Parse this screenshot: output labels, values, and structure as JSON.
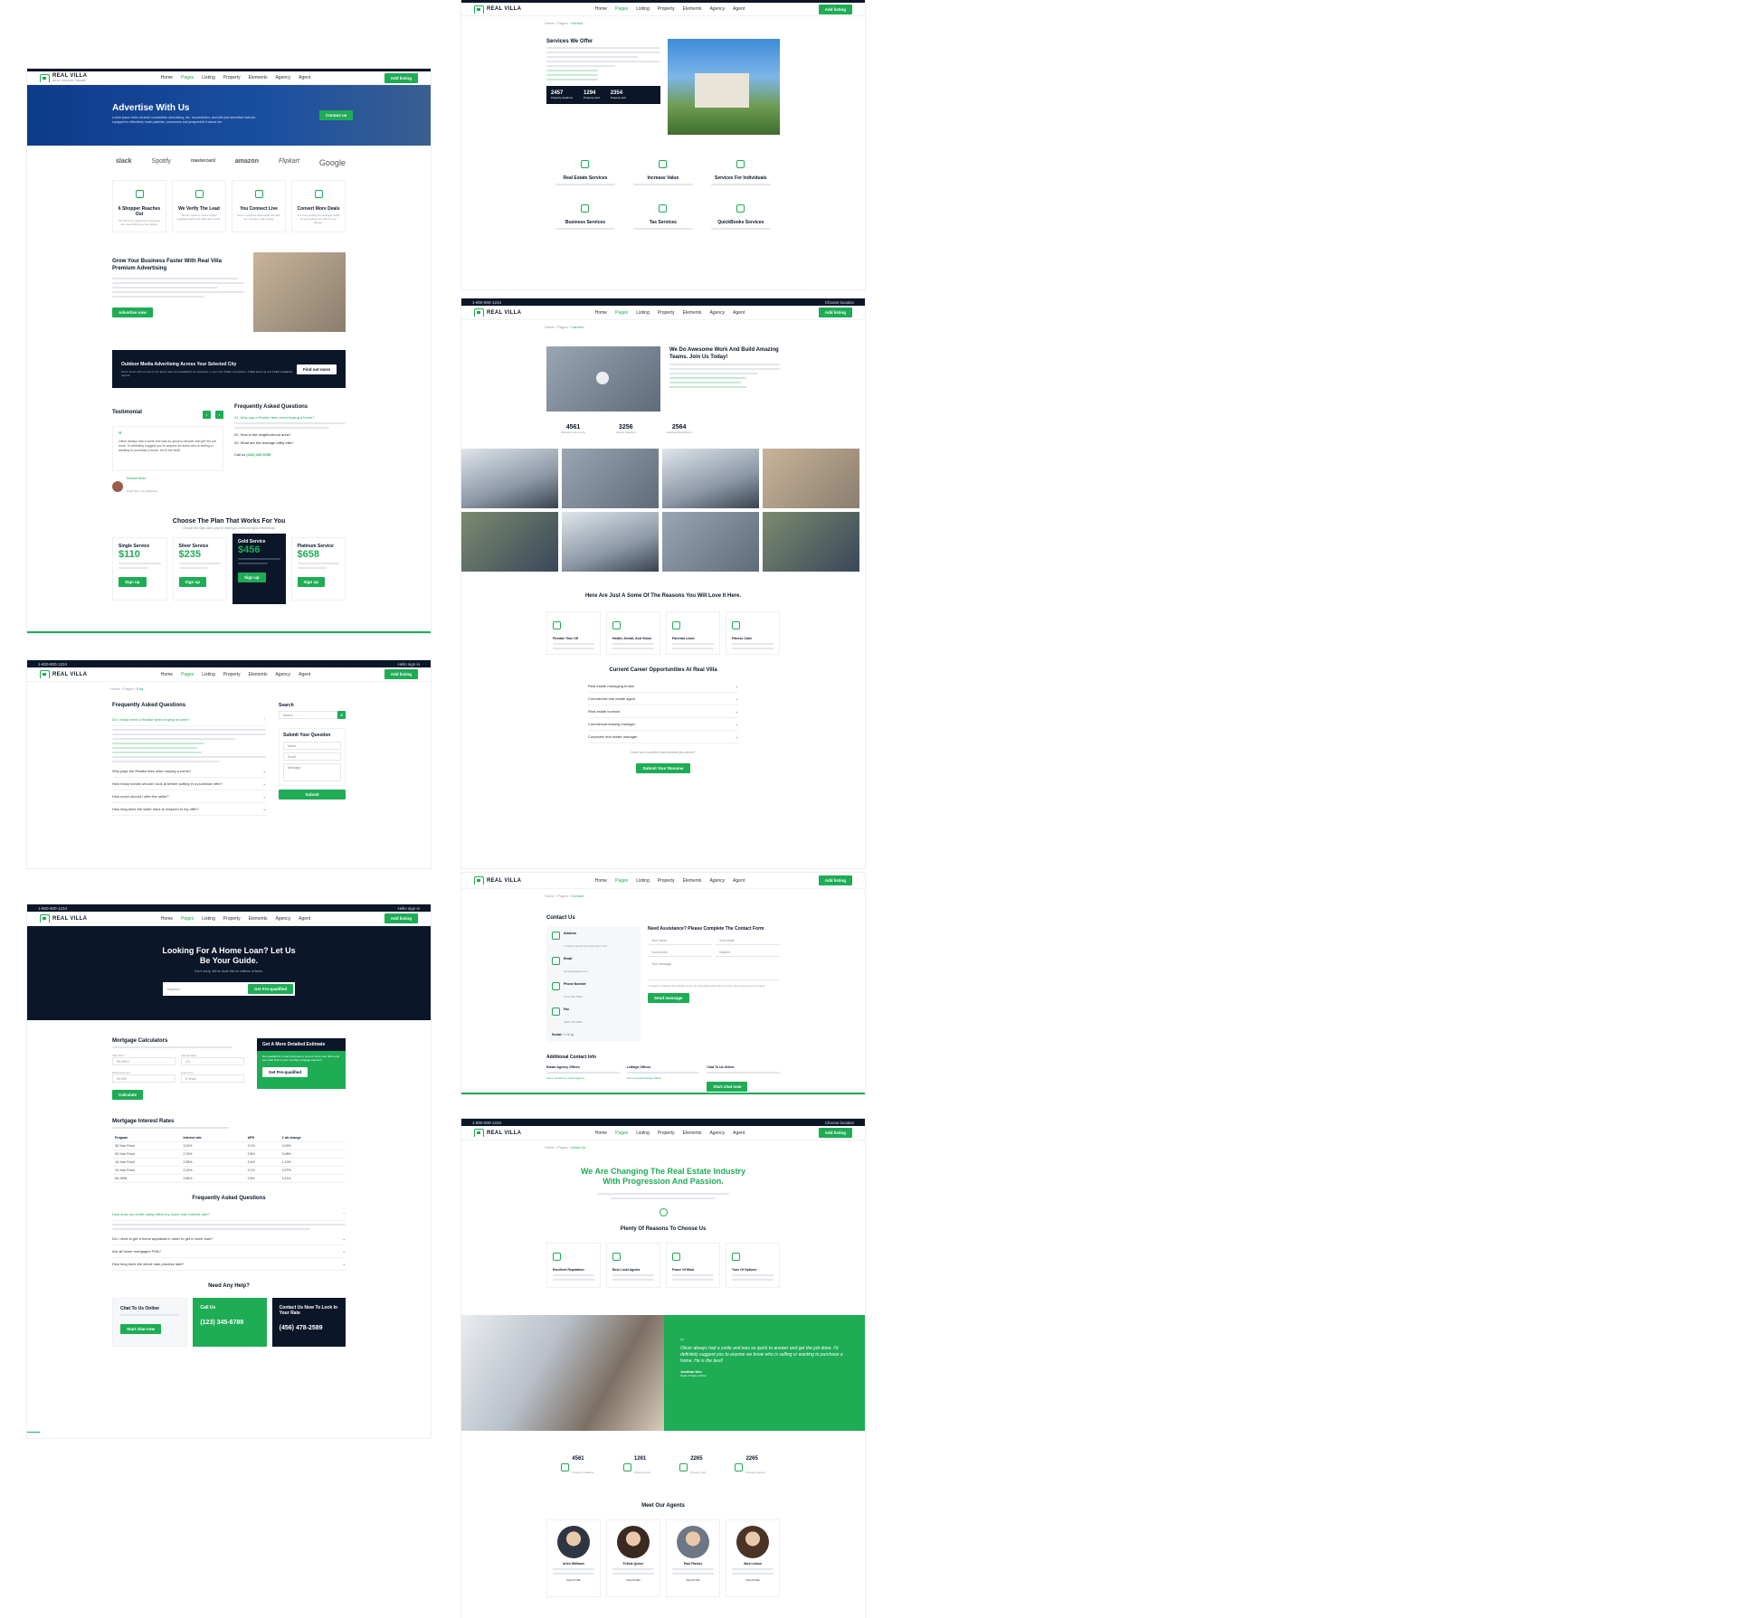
{
  "common": {
    "logo": {
      "name": "REAL VILLA",
      "tagline": "REAL ESTATE THEME"
    },
    "menu": [
      "Home",
      "Pages",
      "Listing",
      "Property",
      "Elements",
      "Agency",
      "Agent"
    ],
    "add_listing": "Add listing",
    "topbar_phone": "1-800-900-1234",
    "topbar_lang": "Get App",
    "topbar_location": "Choose location",
    "topbar_login": "Hello sign in",
    "crumb_home": "Home",
    "crumb_pages": "Pages"
  },
  "advertise": {
    "hero_title": "Advertise With Us",
    "hero_desc": "Lorem ipsum dolor sit amet consectetur advertising, etc. reconnection, and with just advertiser that are equipped to effectively reach patients, consumers and prospective it about are.",
    "hero_btn": "Contact us",
    "brands": [
      "slack",
      "Spotify",
      "mastercard",
      "amazon",
      "Flipkart",
      "Google"
    ],
    "features": [
      {
        "title": "6 Shopper Reaches Out",
        "desc": "The first is to reach key consumers who need what you are selling."
      },
      {
        "title": "We Verify The Lead",
        "desc": "We are quick to review highly engaged leads and pass fast results."
      },
      {
        "title": "You Connect Live",
        "desc": "See in real-time what leads are with our company and pricing."
      },
      {
        "title": "Convert More Deals",
        "desc": "It is true growing the average leads by generating any offers to go deeper."
      }
    ],
    "grow_title": "Grow Your Business Faster With Real Villa Premium Advertising",
    "grow_btn": "Advertise now",
    "outdoor_title": "Outdoor Media Advertising Across Your Selected City",
    "outdoor_desc": "Get in touch with us now for the latest rates and availability for anywhere in your City. FREE consultation, FREE planning and FREE availability reports.",
    "outdoor_btn": "Find out more",
    "testimonial_title": "Testimonial",
    "testimonial_quote": "Oliver always had a smile and was so quick to answer and get the job done. I'd definitely suggest you to anyone we know who is selling or wanting to purchase a home. He is the best!",
    "testimonial_name": "Michael Bean",
    "testimonial_role": "Head Mod, City Marketing",
    "faq_title": "Frequently Asked Questions",
    "faq": [
      "01. Why pay a Realtor fees when buying a home?",
      "02. How is the neighborhood area?",
      "03. What are the average utility bills?"
    ],
    "call_label": "Call us",
    "call_number": "(123) 345 6789",
    "plans_title": "Choose The Plan That Works For You",
    "plans_sub": "Choose the right plan, pay for what you need and grow effortlessly.",
    "plans": [
      {
        "name": "Single Service",
        "price": "$110",
        "btn": "Sign up"
      },
      {
        "name": "Silver Service",
        "price": "$235",
        "btn": "Sign up"
      },
      {
        "name": "Gold Service",
        "price": "$456",
        "btn": "Sign up"
      },
      {
        "name": "Platinum Service",
        "price": "$658",
        "btn": "Sign up"
      }
    ]
  },
  "faq_page": {
    "crumb": "Faq",
    "title": "Frequently Asked Questions",
    "open_q": "Do I really need a Realtor when buying a home?",
    "questions": [
      "Why pays the Realtor fees when buying a home?",
      "How many homes should I look at before putting in a purchase offer?",
      "How much should I offer the seller?",
      "How long does the seller have to respond to my offer?"
    ],
    "search_label": "Search",
    "search_placeholder": "Search ...",
    "submit_title": "Submit Your Question",
    "field_name": "Name",
    "field_email": "Email",
    "field_message": "Message",
    "submit_btn": "Submit"
  },
  "mortgage": {
    "hero_title": "Looking For A Home Loan? Let Us Be Your Guide.",
    "hero_sub": "Don't worry, We've done this for millions of times.",
    "hero_placeholder": "Keyword",
    "hero_btn": "Get Pre-qualified",
    "calc_title": "Mortgage Calculators",
    "calc_fields": [
      {
        "label": "Sale Price",
        "value": "60,000.0"
      },
      {
        "label": "Interest Rate",
        "value": "4.0"
      },
      {
        "label": "Down payment",
        "value": "20,000"
      },
      {
        "label": "Loan term",
        "value": "5 Years"
      }
    ],
    "calc_btn": "Calculate",
    "estimate_title": "Get A More Detailed Estimate",
    "estimate_desc": "Get qualified for a fast fixed-rate of current home loan offers and see what kind of your monthly mortgage payment.",
    "estimate_btn": "Get Pre-qualified",
    "rates_title": "Mortgage Interest Rates",
    "rates_head": [
      "Program",
      "Interest rate",
      "APR",
      "1 wk change"
    ],
    "rates": [
      [
        "30-Year Fixed",
        "3.20%",
        "3.1%",
        "0.02%"
      ],
      [
        "20-Year Fixed",
        "2.76%",
        "2.8%",
        "0.08%"
      ],
      [
        "15-Year Fixed",
        "2.38%",
        "2.4%",
        "1.10%"
      ],
      [
        "10-Year Fixed",
        "2.10%",
        "2.1%",
        "0.27%"
      ],
      [
        "5/1 ARM",
        "2.66%",
        "2.6%",
        "0.11%"
      ]
    ],
    "faq_title": "Frequently Asked Questions",
    "faq_open": "How does my credit rating affect my home loan interest rate?",
    "faq": [
      "Do I need to get a home appraisal in order to get a home loan?",
      "Are all home mortgages FHA?",
      "How long does the whole loan process take?"
    ],
    "help_title": "Need Any Help?",
    "help_cards": [
      {
        "title": "Chat To Us Online",
        "btn": "Start chat now"
      },
      {
        "title": "Call Us",
        "number": "(123) 345-6789"
      },
      {
        "title": "Contact Us Now To Lock In Your Rate",
        "number": "(456) 478-2589"
      }
    ]
  },
  "services": {
    "crumb": "Service",
    "title": "Services We Offer",
    "stats": [
      {
        "num": "2457",
        "label": "Property locations"
      },
      {
        "num": "1294",
        "label": "Property sold"
      },
      {
        "num": "2354",
        "label": "Property sell"
      }
    ],
    "items": [
      {
        "title": "Real Estate Services"
      },
      {
        "title": "Increase Value"
      },
      {
        "title": "Services For Individuals"
      },
      {
        "title": "Business Services"
      },
      {
        "title": "Tax Services"
      },
      {
        "title": "QuickBooks Services"
      }
    ]
  },
  "careers": {
    "crumb": "Careers",
    "title": "We Do Awesome Work And Build Amazing Teams. Join Us Today!",
    "stats": [
      {
        "num": "4561",
        "label": "Working Community"
      },
      {
        "num": "3256",
        "label": "Clients Satisfied"
      },
      {
        "num": "2564",
        "label": "Satisfied Applications"
      }
    ],
    "reasons_title": "Here Are Just A Some Of The Reasons You Will Love It Here.",
    "reasons": [
      {
        "title": "Flexible Time Off"
      },
      {
        "title": "Health, Dental, And Vision"
      },
      {
        "title": "Parental Leave"
      },
      {
        "title": "Fitness Cash"
      }
    ],
    "openings_title": "Current Career Opportunities At Real Villa",
    "openings": [
      "Real estate managing broker",
      "Commercial real estate agent",
      "Real estate investor",
      "Commercial leasing manager",
      "Corporate real estate manager"
    ],
    "resume_note": "Didn't see a position that interests you above?",
    "resume_btn": "Submit Your Resume"
  },
  "contact": {
    "crumb": "Contact",
    "title": "Contact Us",
    "info": [
      {
        "label": "Address",
        "value": "1 Grand Central Terminal, New York"
      },
      {
        "label": "Email",
        "value": "support@gmail.com"
      },
      {
        "label": "Phone Number",
        "value": "(123) 456-7890"
      },
      {
        "label": "Fax",
        "value": "(456) 478-2589"
      }
    ],
    "social_label": "Social:",
    "form_title": "Need Assistance? Please Complete The Contact Form",
    "fields": [
      "Your name",
      "Your email",
      "Your phone",
      "Subject",
      "Your message"
    ],
    "consent": "I consent to having this website store my submitted information so they can respond to my inquiry.",
    "send_btn": "Send message",
    "extra_title": "Additional Contact Info",
    "extra": [
      {
        "title": "Estate Agency Offices",
        "link": "Get in contact by estate agency"
      },
      {
        "title": "Lettings Offices",
        "link": "Get in contact lettings offices"
      },
      {
        "title": "Chat To Us Online",
        "btn": "Start chat now"
      }
    ]
  },
  "about": {
    "crumb": "About Us",
    "hero": "We Are Changing The Real Estate Industry With Progression And Passion.",
    "reasons_title": "Plenty Of Reasons To Choose Us",
    "reasons": [
      {
        "title": "Excellent Reputation"
      },
      {
        "title": "Best Local Agents"
      },
      {
        "title": "Peace Of Mind"
      },
      {
        "title": "Tons Of Options"
      }
    ],
    "quote": "Oliver always had a smile and was so quick to answer and get the job done. I'd definitely suggest you to anyone we know who is selling or wanting to purchase a home. He is the best!",
    "quote_name": "Jonathan Wes",
    "quote_role": "Head of Sales, Dubai",
    "stats": [
      {
        "num": "4561",
        "label": "Property locations"
      },
      {
        "num": "1261",
        "label": "Property sold"
      },
      {
        "num": "2265",
        "label": "Property sell"
      },
      {
        "num": "2265",
        "label": "Property agents"
      }
    ],
    "agents_title": "Meet Our Agents",
    "agents": [
      {
        "name": "Arlen Williams",
        "link": "View Profile"
      },
      {
        "name": "Felicia Queen",
        "link": "View Profile"
      },
      {
        "name": "Paul Flavius",
        "link": "View Profile"
      },
      {
        "name": "Sara Lisbon",
        "link": "View Profile"
      }
    ]
  },
  "colors": {
    "accent": "#1eac55",
    "navy": "#0b1628"
  }
}
